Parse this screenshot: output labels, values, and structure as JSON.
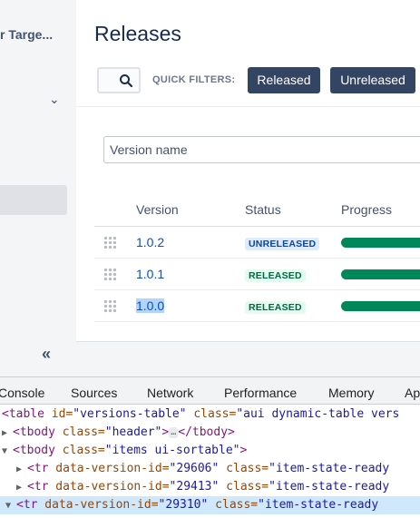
{
  "sidebar": {
    "project_name": "r Targe...",
    "chevron": "⌄",
    "collapse": "«"
  },
  "main": {
    "title": "Releases",
    "quick_filters_label": "QUICK FILTERS:",
    "filters": [
      "Released",
      "Unreleased"
    ],
    "version_input_placeholder": "Version name",
    "columns": [
      "Version",
      "Status",
      "Progress"
    ],
    "rows": [
      {
        "version": "1.0.2",
        "status": "UNRELEASED",
        "progress": 1.0
      },
      {
        "version": "1.0.1",
        "status": "RELEASED",
        "progress": 1.0
      },
      {
        "version": "1.0.0",
        "status": "RELEASED",
        "progress": 1.0
      }
    ]
  },
  "devtools": {
    "tabs": [
      "Console",
      "Sources",
      "Network",
      "Performance",
      "Memory",
      "Ap"
    ],
    "line1": {
      "tag": "<table",
      "a1": " id=",
      "v1": "\"versions-table\"",
      "a2": " class=",
      "v2": "\"aui dynamic-table vers"
    },
    "line2": {
      "tag": "<tbody",
      "a1": " class=",
      "v1": "\"header\"",
      "close": "</tbody>",
      "ellipsis": "…"
    },
    "line3": {
      "tag": "<tbody",
      "a1": " class=",
      "v1": "\"items ui-sortable\"",
      "end": ">"
    },
    "rows": [
      {
        "a1": " data-version-id=",
        "v1": "\"29606\"",
        "a2": " class=",
        "v2": "\"item-state-ready"
      },
      {
        "a1": " data-version-id=",
        "v1": "\"29413\"",
        "a2": " class=",
        "v2": "\"item-state-ready"
      },
      {
        "a1": " data-version-id=",
        "v1": "\"29310\"",
        "a2": " class=",
        "v2": "\"item-state-ready"
      }
    ],
    "tr_tag": "<tr"
  },
  "colors": {
    "accent": "#0052cc",
    "button": "#344563",
    "progress": "#00875a"
  }
}
